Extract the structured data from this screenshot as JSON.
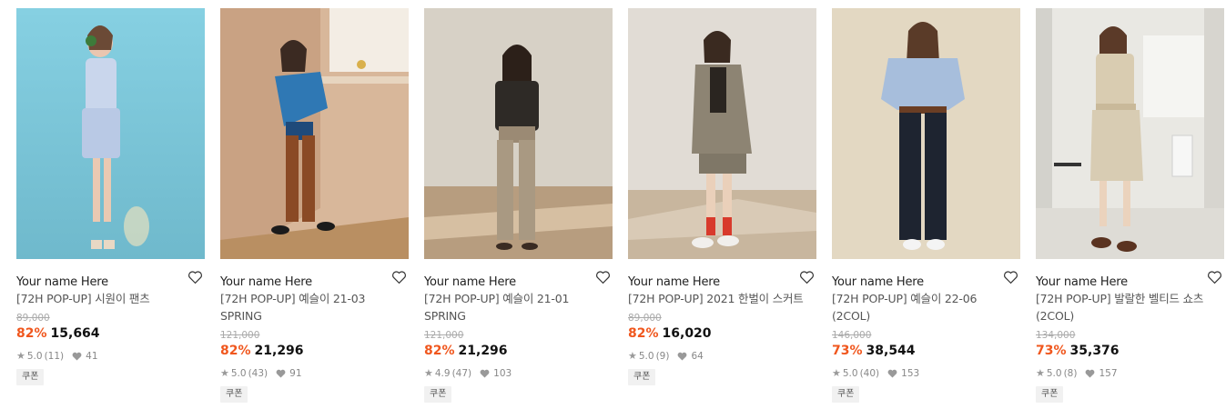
{
  "products": [
    {
      "brand": "Your name Here",
      "title": "[72H POP-UP] 시원이 팬츠",
      "original_price": "89,000",
      "discount": "82%",
      "price": "15,664",
      "rating": "5.0",
      "reviews": "(11)",
      "likes": "41",
      "coupon": "쿠폰",
      "image_desc": "photo-blue-background-gingham-set"
    },
    {
      "brand": "Your name Here",
      "title": "[72H POP-UP] 예슬이 21-03 SPRING",
      "original_price": "121,000",
      "discount": "82%",
      "price": "21,296",
      "rating": "5.0",
      "reviews": "(43)",
      "likes": "91",
      "coupon": "쿠폰",
      "image_desc": "photo-brown-pants-blue-jacket"
    },
    {
      "brand": "Your name Here",
      "title": "[72H POP-UP] 예슬이 21-01 SPRING",
      "original_price": "121,000",
      "discount": "82%",
      "price": "21,296",
      "rating": "4.9",
      "reviews": "(47)",
      "likes": "103",
      "coupon": "쿠폰",
      "image_desc": "photo-beige-slacks-black-top"
    },
    {
      "brand": "Your name Here",
      "title": "[72H POP-UP] 2021 한벌이 스커트",
      "original_price": "89,000",
      "discount": "82%",
      "price": "16,020",
      "rating": "5.0",
      "reviews": "(9)",
      "likes": "64",
      "coupon": "쿠폰",
      "image_desc": "photo-khaki-blazer-skirt"
    },
    {
      "brand": "Your name Here",
      "title": "[72H POP-UP] 예슬이 22-06 (2COL)",
      "original_price": "146,000",
      "discount": "73%",
      "price": "38,544",
      "rating": "5.0",
      "reviews": "(40)",
      "likes": "153",
      "coupon": "쿠폰",
      "image_desc": "photo-light-blue-sweater-black-pants"
    },
    {
      "brand": "Your name Here",
      "title": "[72H POP-UP] 발랄한 벨티드 쇼츠 (2COL)",
      "original_price": "134,000",
      "discount": "73%",
      "price": "35,376",
      "rating": "5.0",
      "reviews": "(8)",
      "likes": "157",
      "coupon": "쿠폰",
      "image_desc": "photo-cream-shirt-belted-shorts"
    }
  ],
  "colors": {
    "discount": "#f0571e",
    "coupon_bg": "#f1f1f1"
  }
}
